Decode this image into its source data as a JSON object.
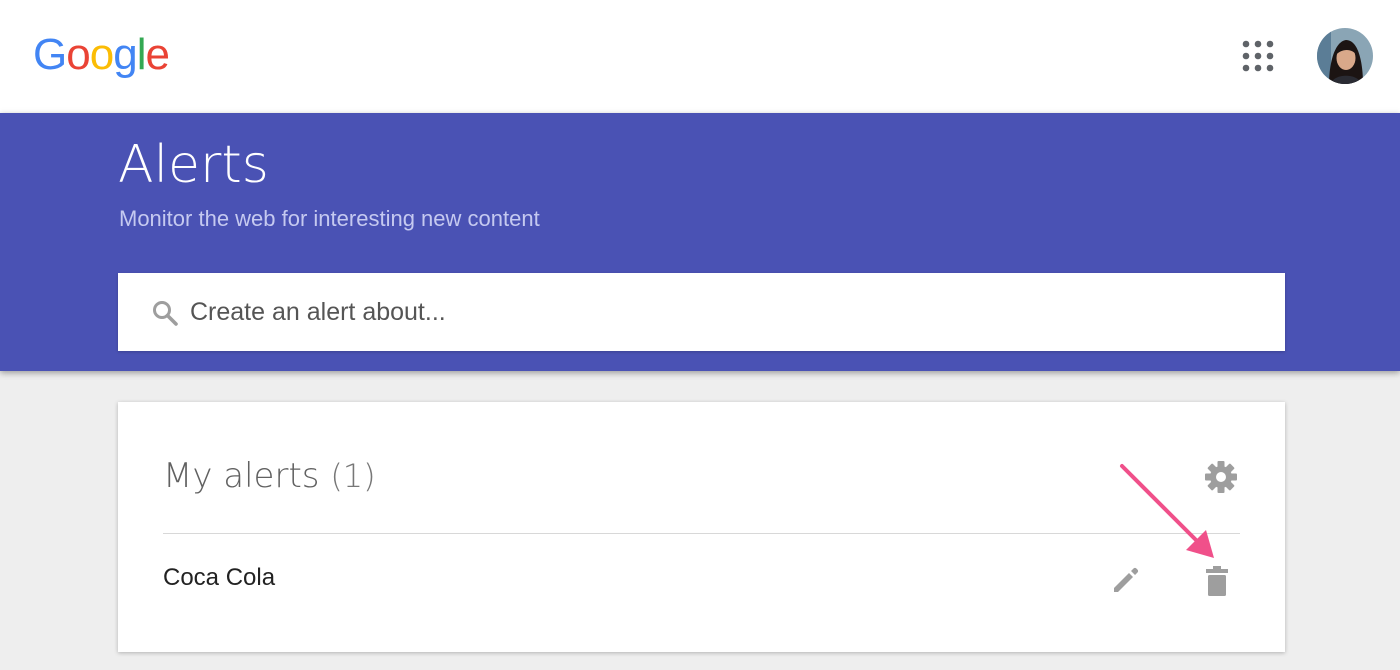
{
  "header": {
    "logo": {
      "letters": [
        {
          "char": "G",
          "color": "#4285F4"
        },
        {
          "char": "o",
          "color": "#EA4335"
        },
        {
          "char": "o",
          "color": "#FBBC05"
        },
        {
          "char": "g",
          "color": "#4285F4"
        },
        {
          "char": "l",
          "color": "#34A853"
        },
        {
          "char": "e",
          "color": "#EA4335"
        }
      ]
    },
    "apps_icon": "apps-grid-icon",
    "avatar": "user-avatar"
  },
  "hero": {
    "title": "Alerts",
    "subtitle": "Monitor the web for interesting new content",
    "background_color": "#4a52b4"
  },
  "search": {
    "placeholder": "Create an alert about...",
    "value": "",
    "icon": "search-icon"
  },
  "alerts_card": {
    "title": "My alerts",
    "count": "(1)",
    "settings_icon": "gear-icon",
    "items": [
      {
        "name": "Coca Cola",
        "edit_icon": "pencil-icon",
        "delete_icon": "trash-icon"
      }
    ]
  },
  "annotation": {
    "arrow_color": "#f0508a"
  }
}
